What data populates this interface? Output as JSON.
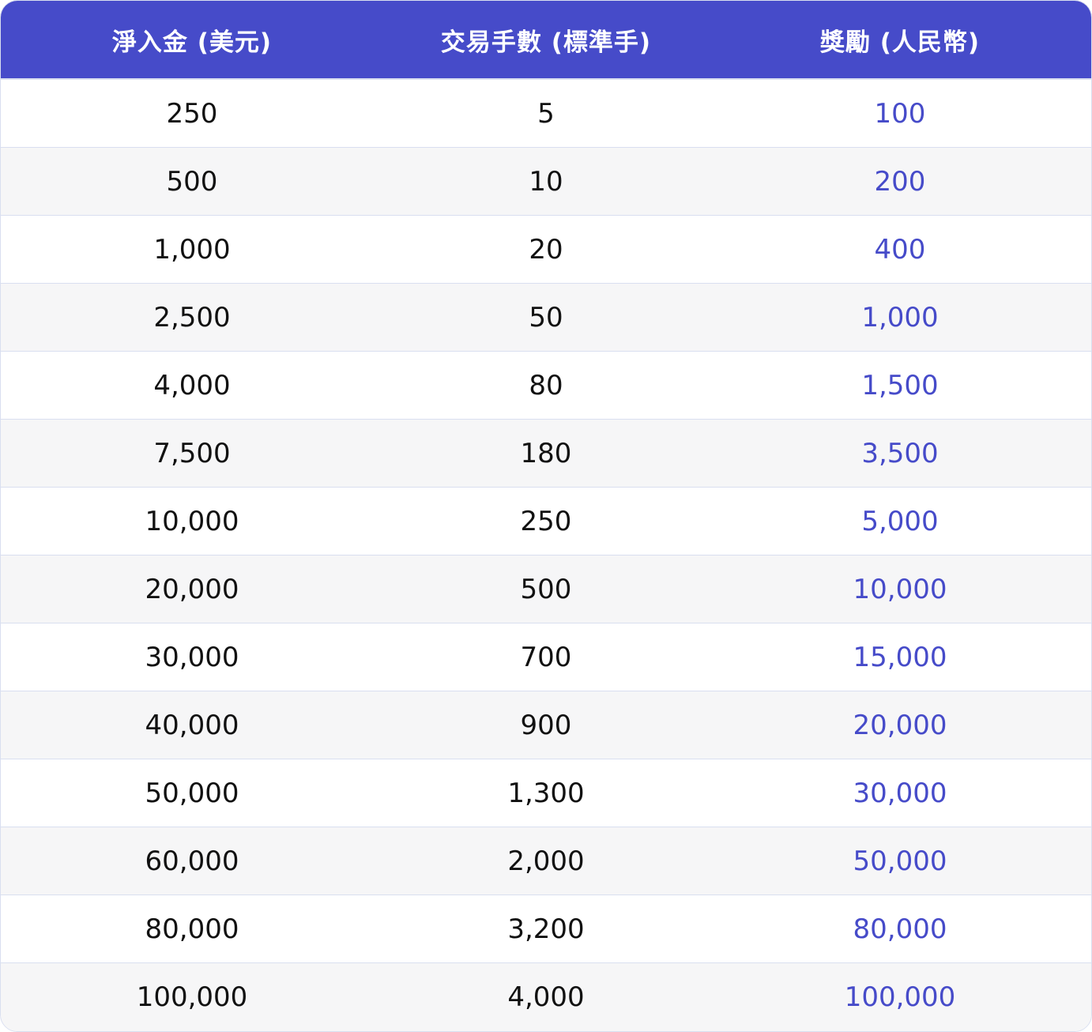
{
  "table": {
    "headers": [
      "淨入金 (美元)",
      "交易手數 (標準手)",
      "獎勵 (人民幣)"
    ],
    "rows": [
      [
        "250",
        "5",
        "100"
      ],
      [
        "500",
        "10",
        "200"
      ],
      [
        "1,000",
        "20",
        "400"
      ],
      [
        "2,500",
        "50",
        "1,000"
      ],
      [
        "4,000",
        "80",
        "1,500"
      ],
      [
        "7,500",
        "180",
        "3,500"
      ],
      [
        "10,000",
        "250",
        "5,000"
      ],
      [
        "20,000",
        "500",
        "10,000"
      ],
      [
        "30,000",
        "700",
        "15,000"
      ],
      [
        "40,000",
        "900",
        "20,000"
      ],
      [
        "50,000",
        "1,300",
        "30,000"
      ],
      [
        "60,000",
        "2,000",
        "50,000"
      ],
      [
        "80,000",
        "3,200",
        "80,000"
      ],
      [
        "100,000",
        "4,000",
        "100,000"
      ]
    ]
  },
  "colors": {
    "header_bg": "#464bc9",
    "header_text": "#ffffff",
    "reward_text": "#464bc9",
    "row_alt_bg": "#f6f6f7",
    "border": "#d9dff0"
  }
}
